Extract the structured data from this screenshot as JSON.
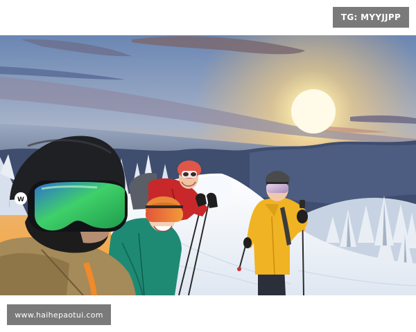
{
  "watermarks": {
    "top_right": "TG: MYYJJPP",
    "bottom_left": "www.haihepaotui.com"
  },
  "photo": {
    "scene": "ski-selfie-mountain-sunset"
  },
  "colors": {
    "watermark_bg": "#7a7a7a",
    "watermark_text": "#ffffff",
    "sky_top": "#5d7dac",
    "sun": "#fff6c8",
    "snow": "#f2f6fb",
    "jacket_yellow": "#f0b323",
    "jacket_red": "#c8282a",
    "jacket_teal": "#1f8a74",
    "goggle_green": "#3fd06a"
  },
  "icons": {
    "helmet_logo": "helmet-logo-icon",
    "ski_pole": "ski-pole-icon"
  }
}
